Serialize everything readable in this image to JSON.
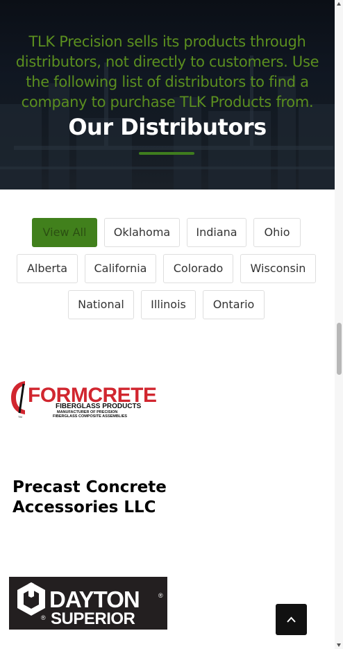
{
  "hero": {
    "intro": "TLK Precision sells its products through distributors, not directly to customers. Use the following list of distributors to find a company to purchase TLK Products from.",
    "title": "Our Distributors"
  },
  "filters": {
    "row1": [
      "View All",
      "Oklahoma",
      "Indiana",
      "Ohio"
    ],
    "row2": [
      "Alberta",
      "California",
      "Colorado",
      "Wisconsin"
    ],
    "row3": [
      "National",
      "Illinois",
      "Ontario"
    ],
    "active": "View All"
  },
  "distributors": {
    "formcrete": {
      "name": "FORMCRETE",
      "sub": "FIBERGLASS PRODUCTS",
      "tagline_1": "MANUFACTURER OF PRECISION",
      "tagline_2": "FIBERGLASS COMPOSITE ASSEMBLIES",
      "tm": "TM"
    },
    "precast": "Precast Concrete Accessories LLC",
    "dayton": {
      "line1": "DAYTON",
      "line2": "SUPERIOR",
      "reg": "®"
    }
  },
  "colors": {
    "accent_green": "#41801c",
    "hero_text_green": "#5b8f1f",
    "formcrete_red": "#d1262f"
  },
  "icons": {
    "back_to_top": "chevron-up-icon"
  }
}
